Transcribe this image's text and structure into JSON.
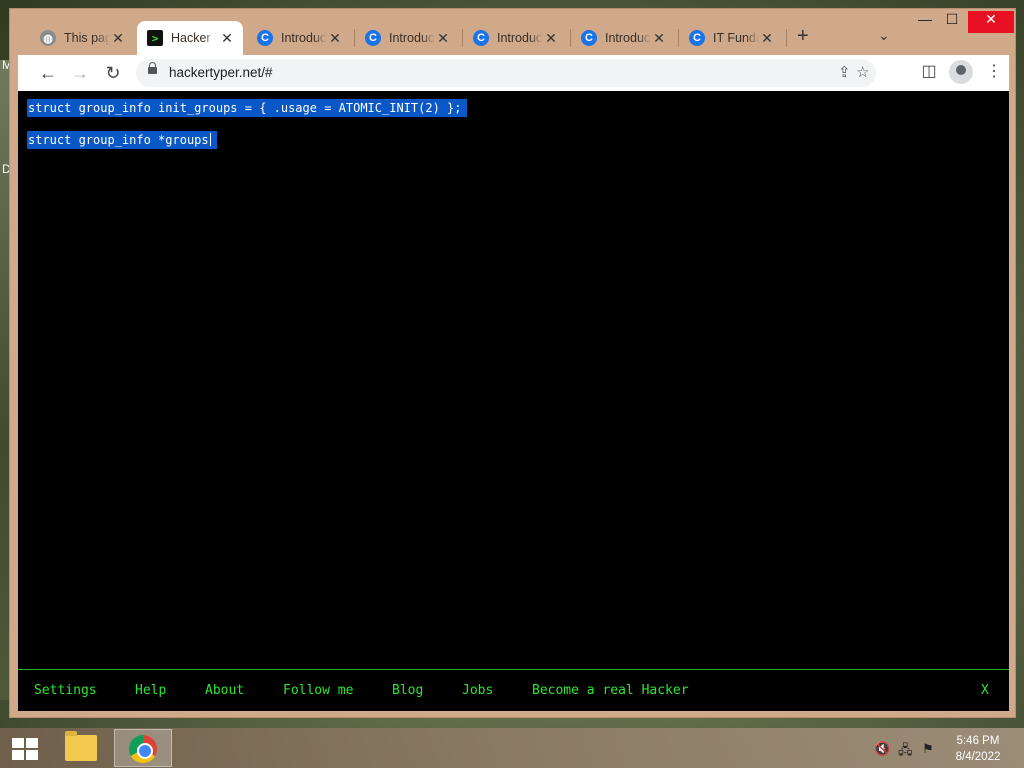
{
  "desktop": {
    "edge_letters": [
      "M",
      "D"
    ]
  },
  "window": {
    "tabs": [
      {
        "title": "This page",
        "icon": "globe-icon"
      },
      {
        "title": "Hacker Typer",
        "icon": "terminal-icon",
        "active": true
      },
      {
        "title": "Introduction",
        "icon": "c-icon"
      },
      {
        "title": "Introduction",
        "icon": "c-icon"
      },
      {
        "title": "Introduction",
        "icon": "c-icon"
      },
      {
        "title": "Introduction",
        "icon": "c-icon"
      },
      {
        "title": "IT Fundamentals",
        "icon": "c-icon"
      }
    ],
    "close_glyph": "✕",
    "newtab_glyph": "+",
    "tabsearch_glyph": "⌄",
    "controls": {
      "minimize": "—",
      "maximize": "☐",
      "close": "✕"
    }
  },
  "toolbar": {
    "back": "←",
    "forward": "→",
    "reload": "↻",
    "url": "hackertyper.net/#",
    "share": "⇪",
    "star": "☆",
    "sidepanel": "◫",
    "menu": "⋮"
  },
  "page": {
    "code_lines": [
      "struct group_info init_groups = { .usage = ATOMIC_INIT(2) };",
      "struct group_info *groups"
    ],
    "footer_links": [
      "Settings",
      "Help",
      "About",
      "Follow me",
      "Blog",
      "Jobs",
      "Become a real Hacker"
    ],
    "footer_close": "X",
    "text_color": "#2ee62e",
    "selection_color": "#0a58c8"
  },
  "taskbar": {
    "time": "5:46 PM",
    "date": "8/4/2022",
    "tray": [
      "volume-muted-icon",
      "network-icon",
      "action-center-flag-icon"
    ]
  }
}
